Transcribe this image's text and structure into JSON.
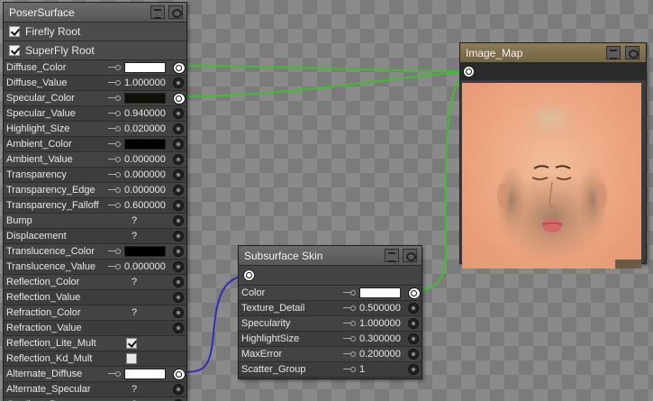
{
  "poser_node": {
    "title": "PoserSurface",
    "headers": [
      {
        "label": "Firefly Root",
        "checked": true
      },
      {
        "label": "SuperFly Root",
        "checked": true
      }
    ],
    "rows": [
      {
        "name": "Diffuse_Color",
        "type": "color",
        "color": "#ffffff",
        "connected": true
      },
      {
        "name": "Diffuse_Value",
        "type": "number",
        "value": "1.000000"
      },
      {
        "name": "Specular_Color",
        "type": "color",
        "color": "#101008",
        "connected": true
      },
      {
        "name": "Specular_Value",
        "type": "number",
        "value": "0.940000"
      },
      {
        "name": "Highlight_Size",
        "type": "number",
        "value": "0.020000"
      },
      {
        "name": "Ambient_Color",
        "type": "color",
        "color": "#000000"
      },
      {
        "name": "Ambient_Value",
        "type": "number",
        "value": "0.000000"
      },
      {
        "name": "Transparency",
        "type": "number",
        "value": "0.000000"
      },
      {
        "name": "Transparency_Edge",
        "type": "number",
        "value": "0.000000"
      },
      {
        "name": "Transparency_Falloff",
        "type": "number",
        "value": "0.600000"
      },
      {
        "name": "Bump",
        "type": "unknown",
        "value": "?"
      },
      {
        "name": "Displacement",
        "type": "unknown",
        "value": "?"
      },
      {
        "name": "Translucence_Color",
        "type": "color",
        "color": "#000000"
      },
      {
        "name": "Translucence_Value",
        "type": "number",
        "value": "0.000000"
      },
      {
        "name": "Reflection_Color",
        "type": "unknown",
        "value": "?"
      },
      {
        "name": "Reflection_Value",
        "type": "none"
      },
      {
        "name": "Refraction_Color",
        "type": "unknown",
        "value": "?"
      },
      {
        "name": "Refraction_Value",
        "type": "none"
      },
      {
        "name": "Reflection_Lite_Mult",
        "type": "checkbox",
        "checked": true
      },
      {
        "name": "Reflection_Kd_Mult",
        "type": "checkbox",
        "checked": false
      },
      {
        "name": "Alternate_Diffuse",
        "type": "color",
        "color": "#ffffff",
        "connected": true
      },
      {
        "name": "Alternate_Specular",
        "type": "unknown",
        "value": "?"
      },
      {
        "name": "Gradient_Bump",
        "type": "unknown",
        "value": "?"
      }
    ]
  },
  "image_map_node": {
    "title": "Image_Map",
    "accent": "#7f7150"
  },
  "subsurface_node": {
    "title": "Subsurface Skin",
    "rows": [
      {
        "name": "Color",
        "type": "color",
        "color": "#ffffff",
        "connected": true
      },
      {
        "name": "Texture_Detail",
        "type": "number",
        "value": "0.500000"
      },
      {
        "name": "Specularity",
        "type": "number",
        "value": "1.000000"
      },
      {
        "name": "HighlightSize",
        "type": "number",
        "value": "0.300000"
      },
      {
        "name": "MaxError",
        "type": "number",
        "value": "0.200000"
      },
      {
        "name": "Scatter_Group",
        "type": "number",
        "value": "1"
      }
    ]
  },
  "wires": {
    "green": "#3fbf2f",
    "blue": "#2b2fbf"
  }
}
